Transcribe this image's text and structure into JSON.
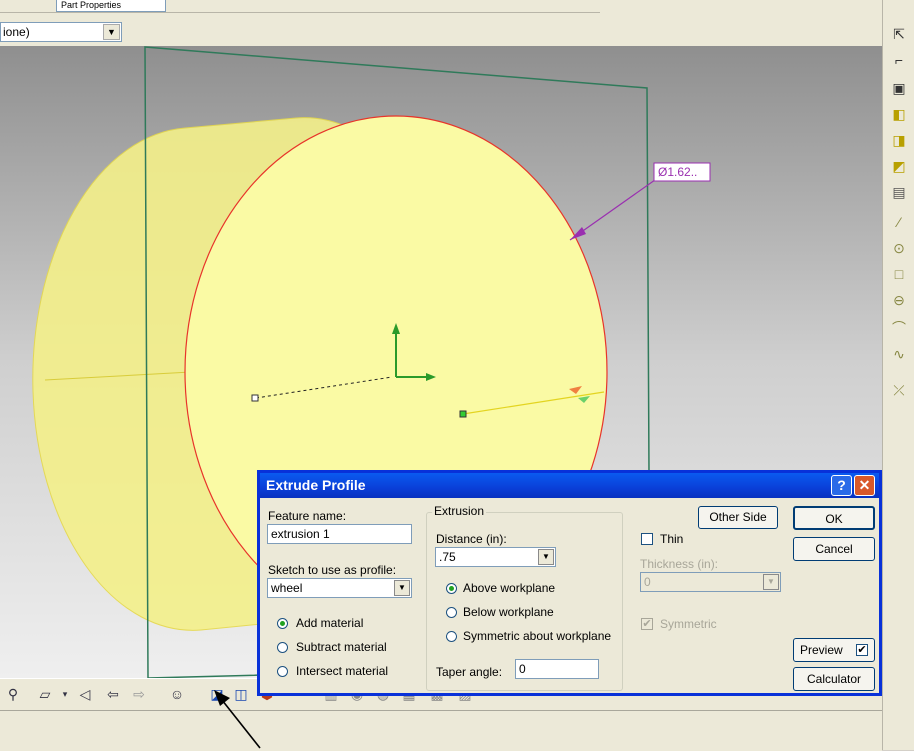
{
  "toolbar_top": {
    "field_text": "Part Properties",
    "combo_value": "ione)"
  },
  "viewport": {
    "dimension_label": "Ø1.62.."
  },
  "dialog": {
    "title": "Extrude Profile",
    "help_btn": "?",
    "close_btn": "✕",
    "feature_name_label": "Feature name:",
    "feature_name_value": "extrusion 1",
    "sketch_label": "Sketch to use as profile:",
    "sketch_value": "wheel",
    "material_options": [
      "Add material",
      "Subtract material",
      "Intersect material"
    ],
    "material_selected": 0,
    "extrusion_group": "Extrusion",
    "distance_label": "Distance (in):",
    "distance_value": ".75",
    "placement_options": [
      "Above workplane",
      "Below workplane",
      "Symmetric about workplane"
    ],
    "placement_selected": 0,
    "taper_label": "Taper angle:",
    "taper_value": "0",
    "other_side": "Other Side",
    "thin_label": "Thin",
    "thickness_label": "Thickness (in):",
    "thickness_value": "0",
    "symmetric_label": "Symmetric",
    "ok": "OK",
    "cancel": "Cancel",
    "preview": "Preview",
    "calculator": "Calculator"
  },
  "icons_right": [
    "select-icon",
    "sketch-icon",
    "workplane-icon",
    "extrude-icon",
    "revolve-icon",
    "sweep-icon",
    "loft-icon",
    "line-icon",
    "circle-icon",
    "rectangle-icon",
    "ellipse-icon",
    "arc-icon",
    "spline-icon",
    "trim-icon"
  ],
  "icons_bottom": [
    "zoom-icon",
    "workplane-tool-icon",
    "view-dropdown-icon",
    "back-icon",
    "forward-icon",
    "smiley-icon",
    "extrude-tool-icon",
    "revolve-tool-icon",
    "sweep-tool-icon",
    "loft-tool-icon",
    "hole-icon",
    "shell-icon",
    "fillet-icon",
    "chamfer-icon",
    "pattern-icon",
    "mirror-icon"
  ]
}
